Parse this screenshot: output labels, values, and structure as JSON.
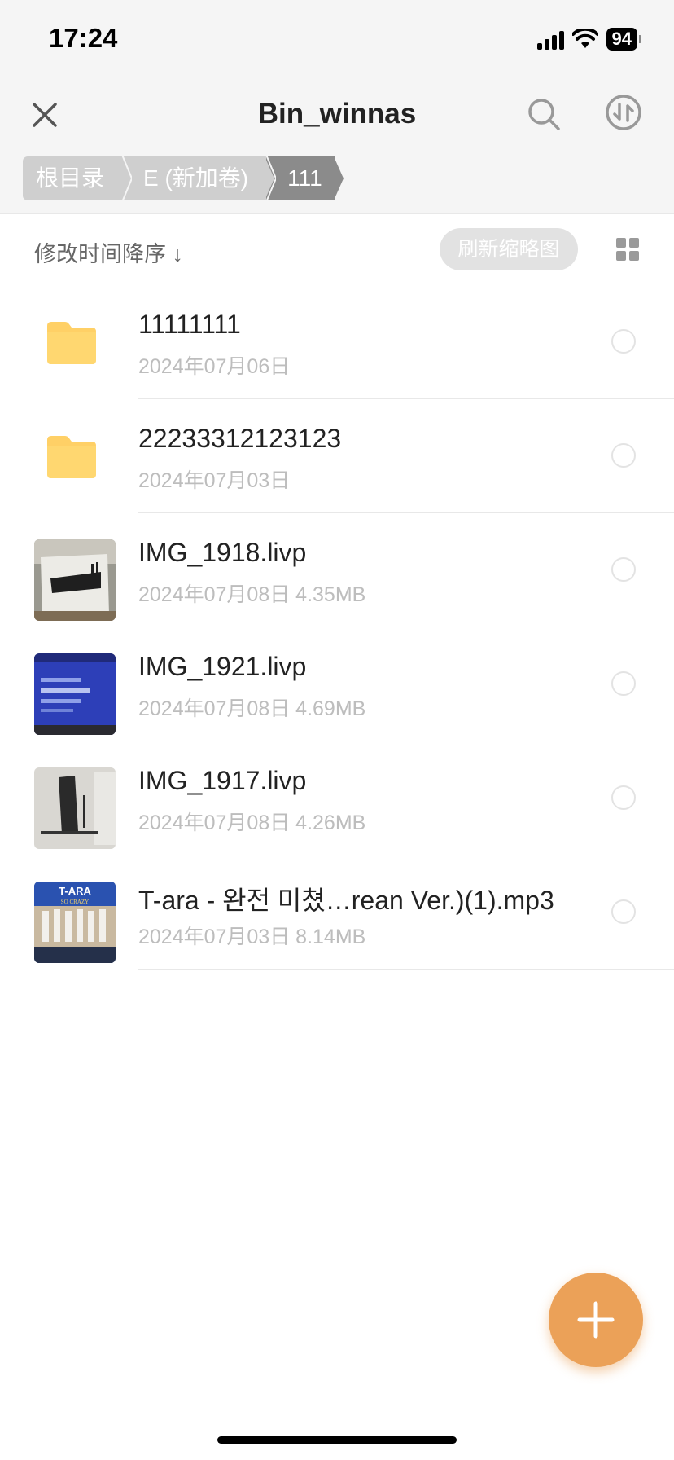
{
  "status_bar": {
    "time": "17:24",
    "battery": "94"
  },
  "nav": {
    "title": "Bin_winnas"
  },
  "breadcrumb": [
    {
      "label": "根目录"
    },
    {
      "label": "E (新加卷)"
    },
    {
      "label": "111"
    }
  ],
  "toolbar": {
    "sort_label": "修改时间降序 ↓",
    "refresh_label": "刷新缩略图"
  },
  "files": [
    {
      "name": "11111111",
      "meta": "2024年07月06日",
      "type": "folder"
    },
    {
      "name": "22233312123123",
      "meta": "2024年07月03日",
      "type": "folder"
    },
    {
      "name": "IMG_1918.livp",
      "meta": "2024年07月08日  4.35MB",
      "type": "image"
    },
    {
      "name": "IMG_1921.livp",
      "meta": "2024年07月08日  4.69MB",
      "type": "image"
    },
    {
      "name": "IMG_1917.livp",
      "meta": "2024年07月08日  4.26MB",
      "type": "image"
    },
    {
      "name": "T-ara - 완전 미쳤…rean Ver.)(1).mp3",
      "meta": "2024年07月03日  8.14MB",
      "type": "audio"
    }
  ],
  "thumbnails": {
    "album_text": "T-ARA",
    "album_subtext": "SO CRAZY"
  },
  "colors": {
    "accent": "#eba158",
    "folder": "#ffd066",
    "crumb": "#cfcfcf",
    "crumb_active": "#8b8b8b"
  },
  "icons": {
    "close": "close-icon",
    "search": "search-icon",
    "transfer": "transfer-icon",
    "grid": "grid-view-icon",
    "folder": "folder-icon",
    "add": "plus-icon"
  }
}
